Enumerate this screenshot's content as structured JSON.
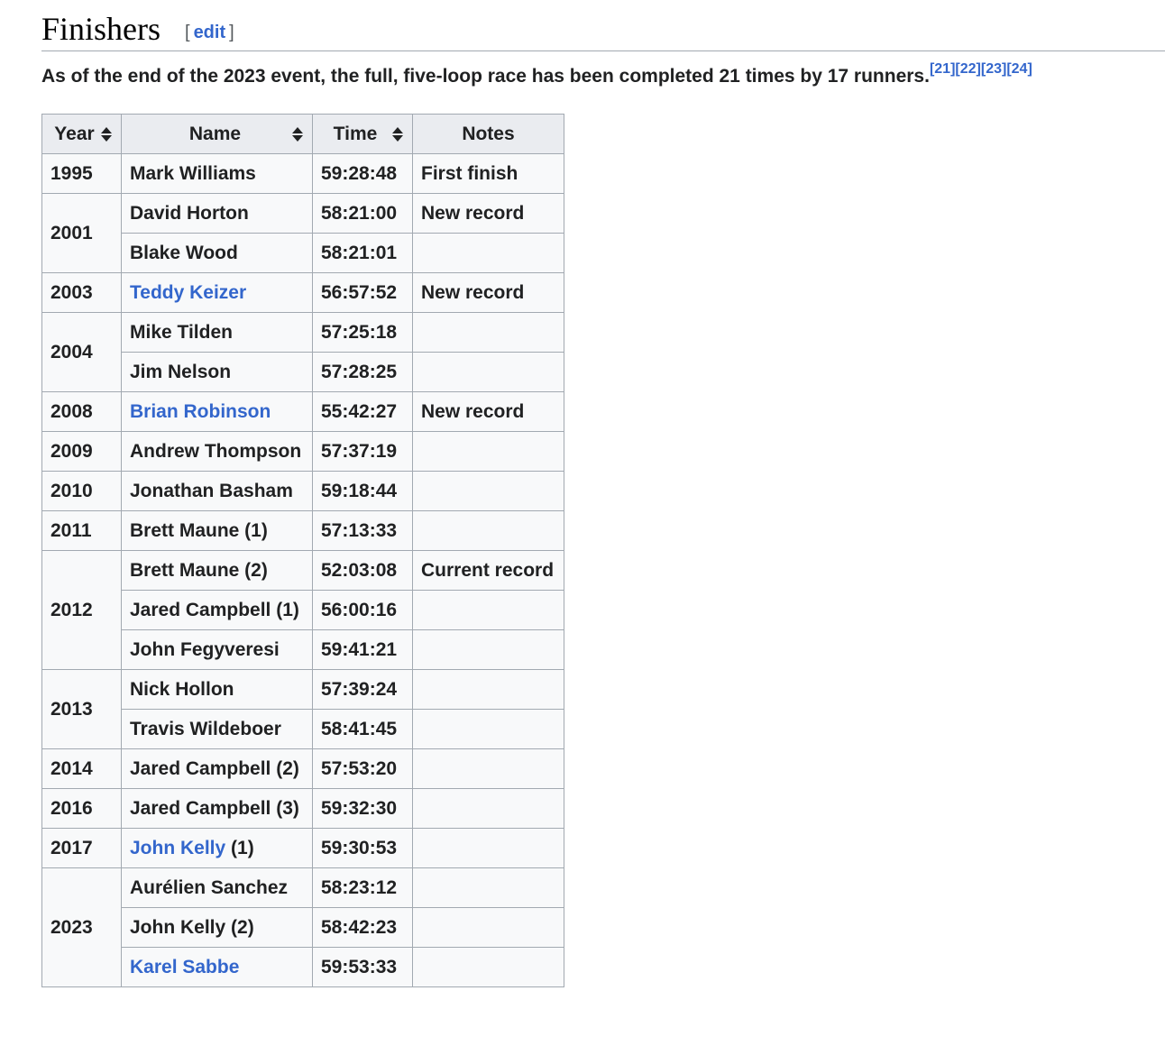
{
  "section": {
    "title": "Finishers",
    "edit_open": "[",
    "edit_label": "edit",
    "edit_close": "]"
  },
  "intro": {
    "text": "As of the end of the 2023 event, the full, five-loop race has been completed 21 times by 17 runners.",
    "refs": [
      "[21]",
      "[22]",
      "[23]",
      "[24]"
    ]
  },
  "table": {
    "headers": [
      "Year",
      "Name",
      "Time",
      "Notes"
    ],
    "sortable": [
      true,
      true,
      true,
      false
    ],
    "groups": [
      {
        "year": "1995",
        "rows": [
          {
            "name": "Mark Williams",
            "link": false,
            "time": "59:28:48",
            "notes": "First finish"
          }
        ]
      },
      {
        "year": "2001",
        "rows": [
          {
            "name": "David Horton",
            "link": false,
            "time": "58:21:00",
            "notes": "New record"
          },
          {
            "name": "Blake Wood",
            "link": false,
            "time": "58:21:01",
            "notes": ""
          }
        ]
      },
      {
        "year": "2003",
        "rows": [
          {
            "name": "Teddy Keizer",
            "link": true,
            "time": "56:57:52",
            "notes": "New record"
          }
        ]
      },
      {
        "year": "2004",
        "rows": [
          {
            "name": "Mike Tilden",
            "link": false,
            "time": "57:25:18",
            "notes": ""
          },
          {
            "name": "Jim Nelson",
            "link": false,
            "time": "57:28:25",
            "notes": ""
          }
        ]
      },
      {
        "year": "2008",
        "rows": [
          {
            "name": "Brian Robinson",
            "link": true,
            "time": "55:42:27",
            "notes": "New record"
          }
        ]
      },
      {
        "year": "2009",
        "rows": [
          {
            "name": "Andrew Thompson",
            "link": false,
            "time": "57:37:19",
            "notes": ""
          }
        ]
      },
      {
        "year": "2010",
        "rows": [
          {
            "name": "Jonathan Basham",
            "link": false,
            "time": "59:18:44",
            "notes": ""
          }
        ]
      },
      {
        "year": "2011",
        "rows": [
          {
            "name": "Brett Maune (1)",
            "link": false,
            "time": "57:13:33",
            "notes": ""
          }
        ]
      },
      {
        "year": "2012",
        "rows": [
          {
            "name": "Brett Maune (2)",
            "link": false,
            "time": "52:03:08",
            "notes": "Current record"
          },
          {
            "name": "Jared Campbell (1)",
            "link": false,
            "time": "56:00:16",
            "notes": ""
          },
          {
            "name": "John Fegyveresi",
            "link": false,
            "time": "59:41:21",
            "notes": ""
          }
        ]
      },
      {
        "year": "2013",
        "rows": [
          {
            "name": "Nick Hollon",
            "link": false,
            "time": "57:39:24",
            "notes": ""
          },
          {
            "name": "Travis Wildeboer",
            "link": false,
            "time": "58:41:45",
            "notes": ""
          }
        ]
      },
      {
        "year": "2014",
        "rows": [
          {
            "name": "Jared Campbell (2)",
            "link": false,
            "time": "57:53:20",
            "notes": ""
          }
        ]
      },
      {
        "year": "2016",
        "rows": [
          {
            "name": "Jared Campbell (3)",
            "link": false,
            "time": "59:32:30",
            "notes": ""
          }
        ]
      },
      {
        "year": "2017",
        "rows": [
          {
            "name": "John Kelly",
            "suffix": " (1)",
            "link": true,
            "time": "59:30:53",
            "notes": ""
          }
        ]
      },
      {
        "year": "2023",
        "rows": [
          {
            "name": "Aurélien Sanchez",
            "link": false,
            "time": "58:23:12",
            "notes": ""
          },
          {
            "name": "John Kelly (2)",
            "link": false,
            "time": "58:42:23",
            "notes": ""
          },
          {
            "name": "Karel Sabbe",
            "link": true,
            "time": "59:53:33",
            "notes": ""
          }
        ]
      }
    ]
  },
  "colors": {
    "link": "#3366cc",
    "header_bg": "#eaecf0",
    "table_bg": "#f8f9fa",
    "border": "#a2a9b1"
  }
}
